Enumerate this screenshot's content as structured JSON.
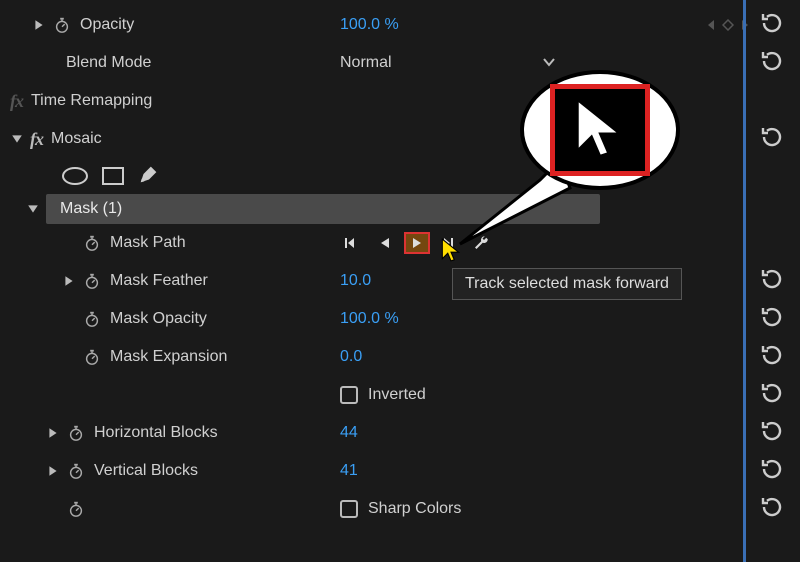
{
  "opacity": {
    "label": "Opacity",
    "value": "100.0 %"
  },
  "blendMode": {
    "label": "Blend Mode",
    "value": "Normal"
  },
  "timeRemapping": {
    "label": "Time Remapping"
  },
  "mosaic": {
    "label": "Mosaic"
  },
  "mask": {
    "label": "Mask (1)"
  },
  "maskPath": {
    "label": "Mask Path"
  },
  "maskFeather": {
    "label": "Mask Feather",
    "value": "10.0"
  },
  "maskOpacity": {
    "label": "Mask Opacity",
    "value": "100.0 %"
  },
  "maskExpansion": {
    "label": "Mask Expansion",
    "value": "0.0"
  },
  "inverted": {
    "label": "Inverted"
  },
  "horizontalBlocks": {
    "label": "Horizontal Blocks",
    "value": "44"
  },
  "verticalBlocks": {
    "label": "Vertical Blocks",
    "value": "41"
  },
  "sharpColors": {
    "label": "Sharp Colors"
  },
  "tooltip": "Track selected mask forward"
}
